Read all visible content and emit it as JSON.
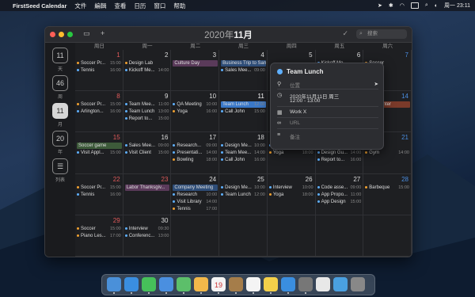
{
  "menubar": {
    "apple": "",
    "app": "FirstSeed Calendar",
    "items": [
      "文件",
      "編輯",
      "查看",
      "日历",
      "窗口",
      "帮助"
    ],
    "clock": "周一 23:11"
  },
  "window": {
    "title_year": "2020年",
    "title_month": "11月",
    "add_label": "+",
    "search_placeholder": "搜索",
    "check_label": "✓"
  },
  "sidebar": [
    {
      "num": "11",
      "label": "天"
    },
    {
      "num": "46",
      "label": "周"
    },
    {
      "num": "11",
      "label": "月"
    },
    {
      "num": "20",
      "label": "年"
    },
    {
      "num": "☰",
      "label": "列表"
    }
  ],
  "day_headers": [
    "周日",
    "周一",
    "周二",
    "周三",
    "周四",
    "周五",
    "周六"
  ],
  "weeks": [
    [
      {
        "d": "1",
        "c": "red",
        "ev": [
          {
            "t": "Soccer Pr...",
            "tm": "15:00",
            "col": "#f0a030"
          },
          {
            "t": "Tennis",
            "tm": "16:00",
            "col": "#5fb0ff"
          }
        ]
      },
      {
        "d": "2",
        "ev": [
          {
            "t": "Design Lab",
            "tm": "",
            "col": "#f0a030"
          },
          {
            "t": "Kickoff Me...",
            "tm": "14:00",
            "col": "#5fb0ff"
          }
        ]
      },
      {
        "d": "3",
        "ev": [
          {
            "t": "Culture Day",
            "bar": "#5a3a5a"
          }
        ]
      },
      {
        "d": "4",
        "ev": [
          {
            "t": "Business Trip to San Francisco",
            "bar": "#2e4d78"
          },
          {
            "t": "Sales Mee...",
            "tm": "09:00",
            "col": "#5fb0ff"
          }
        ]
      },
      {
        "d": "5",
        "ev": []
      },
      {
        "d": "6",
        "ev": [
          {
            "t": "Kickoff Me...",
            "tm": "",
            "col": "#5fb0ff"
          },
          {
            "t": "",
            "tm": "",
            "col": ""
          }
        ]
      },
      {
        "d": "7",
        "c": "blue",
        "ev": [
          {
            "t": "Soccer",
            "tm": "",
            "col": "#f0a030"
          },
          {
            "t": "Game",
            "tm": "",
            "col": "#5fb0ff"
          }
        ]
      }
    ],
    [
      {
        "d": "8",
        "c": "red",
        "ev": [
          {
            "t": "Soccer Pr...",
            "tm": "15:00",
            "col": "#f0a030"
          },
          {
            "t": "Arlington...",
            "tm": "16:00",
            "col": "#5fb0ff"
          }
        ]
      },
      {
        "d": "9",
        "ev": [
          {
            "t": "Team Mee...",
            "tm": "11:00",
            "col": "#5fb0ff"
          },
          {
            "t": "Team Lunch",
            "tm": "13:00",
            "col": "#5fb0ff"
          },
          {
            "t": "Report to...",
            "tm": "15:00",
            "col": "#5fb0ff"
          }
        ]
      },
      {
        "d": "10",
        "ev": [
          {
            "t": "QA Meeting",
            "tm": "10:00",
            "col": "#5fb0ff"
          },
          {
            "t": "Yoga",
            "tm": "16:00",
            "col": "#f0a030"
          }
        ]
      },
      {
        "d": "11",
        "c": "today",
        "ev": [
          {
            "t": "Team Lunch",
            "tm": "12:00",
            "bar": "#3a78c8"
          },
          {
            "t": "Call John",
            "tm": "15:00",
            "col": "#5fb0ff"
          }
        ]
      },
      {
        "d": "12",
        "ev": []
      },
      {
        "d": "13",
        "ev": []
      },
      {
        "d": "14",
        "c": "blue",
        "ev": [
          {
            "t": "Port Center",
            "bar": "#7a3a2a"
          }
        ]
      }
    ],
    [
      {
        "d": "15",
        "c": "red",
        "ev": [
          {
            "t": "Soccer game",
            "bar": "#3d5a3a"
          },
          {
            "t": "Visit Appl...",
            "tm": "15:00",
            "col": "#5fb0ff"
          }
        ]
      },
      {
        "d": "16",
        "ev": [
          {
            "t": "Sales Mee...",
            "tm": "09:00",
            "col": "#5fb0ff"
          },
          {
            "t": "Visit Client",
            "tm": "15:00",
            "col": "#5fb0ff"
          }
        ]
      },
      {
        "d": "17",
        "ev": [
          {
            "t": "Research...",
            "tm": "09:00",
            "col": "#5fb0ff"
          },
          {
            "t": "Presentati...",
            "tm": "14:00",
            "col": "#5fb0ff"
          },
          {
            "t": "Bowling",
            "tm": "18:00",
            "col": "#f0a030"
          }
        ]
      },
      {
        "d": "18",
        "ev": [
          {
            "t": "Design Me...",
            "tm": "10:00",
            "col": "#5fb0ff"
          },
          {
            "t": "Team Mee...",
            "tm": "14:00",
            "col": "#5fb0ff"
          },
          {
            "t": "Call John",
            "tm": "16:00",
            "col": "#5fb0ff"
          }
        ]
      },
      {
        "d": "19",
        "ev": [
          {
            "t": "Brainstor...",
            "tm": "10:00",
            "col": "#5fb0ff"
          },
          {
            "t": "Yoga",
            "tm": "18:00",
            "col": "#f0a030"
          }
        ]
      },
      {
        "d": "20",
        "ev": [
          {
            "t": "Visit Apple",
            "tm": "",
            "bar": "#2e4d78"
          },
          {
            "t": "Design Gu...",
            "tm": "14:00",
            "col": "#5fb0ff"
          },
          {
            "t": "Report to...",
            "tm": "16:00",
            "col": "#5fb0ff"
          }
        ]
      },
      {
        "d": "21",
        "c": "blue",
        "ev": [
          {
            "t": "",
            "tm": "",
            "col": ""
          },
          {
            "t": "Gym",
            "tm": "14:00",
            "col": "#f0a030"
          }
        ]
      }
    ],
    [
      {
        "d": "22",
        "c": "red",
        "ev": [
          {
            "t": "Soccer Pr...",
            "tm": "15:00",
            "col": "#f0a030"
          },
          {
            "t": "Tennis",
            "tm": "16:00",
            "col": "#5fb0ff"
          }
        ]
      },
      {
        "d": "23",
        "c": "red",
        "ev": [
          {
            "t": "Labor Thanksgiv...",
            "bar": "#5a3a5a"
          }
        ]
      },
      {
        "d": "24",
        "ev": [
          {
            "t": "Company Meeting",
            "bar": "#2e4d78"
          },
          {
            "t": "Research",
            "tm": "10:00",
            "col": "#5fb0ff"
          },
          {
            "t": "Visit Library",
            "tm": "14:00",
            "col": "#5fb0ff"
          },
          {
            "t": "Tennis",
            "tm": "17:00",
            "col": "#f0a030"
          }
        ]
      },
      {
        "d": "25",
        "ev": [
          {
            "t": "Design Me...",
            "tm": "10:00",
            "col": "#5fb0ff"
          },
          {
            "t": "Team Lunch",
            "tm": "12:00",
            "col": "#5fb0ff"
          }
        ]
      },
      {
        "d": "26",
        "ev": [
          {
            "t": "Interview",
            "tm": "10:00",
            "col": "#5fb0ff"
          },
          {
            "t": "Yoga",
            "tm": "18:00",
            "col": "#f0a030"
          }
        ]
      },
      {
        "d": "27",
        "ev": [
          {
            "t": "Code asse...",
            "tm": "09:00",
            "col": "#5fb0ff"
          },
          {
            "t": "App Propo...",
            "tm": "11:00",
            "col": "#5fb0ff"
          },
          {
            "t": "App Design",
            "tm": "15:00",
            "col": "#5fb0ff"
          }
        ]
      },
      {
        "d": "28",
        "c": "blue",
        "ev": [
          {
            "t": "Barbeque",
            "tm": "15:00",
            "col": "#f0a030"
          }
        ]
      }
    ],
    [
      {
        "d": "29",
        "c": "red",
        "ev": [
          {
            "t": "Soccer",
            "tm": "15:00",
            "col": "#f0a030"
          },
          {
            "t": "Piano Les...",
            "tm": "17:00",
            "col": "#f0a030"
          }
        ]
      },
      {
        "d": "30",
        "ev": [
          {
            "t": "Interview",
            "tm": "09:30",
            "col": "#5fb0ff"
          },
          {
            "t": "Conferenc...",
            "tm": "13:00",
            "col": "#5fb0ff"
          }
        ]
      },
      {
        "d": "",
        "ev": []
      },
      {
        "d": "",
        "ev": []
      },
      {
        "d": "",
        "ev": []
      },
      {
        "d": "",
        "ev": []
      },
      {
        "d": "",
        "ev": []
      }
    ]
  ],
  "popover": {
    "title": "Team Lunch",
    "location_placeholder": "位置",
    "date_line": "2020年11月11日 周三",
    "time_line": "12:00 - 13:00",
    "calendar": "Work X",
    "url_placeholder": "URL",
    "notes_placeholder": "备注"
  },
  "dock": [
    {
      "name": "finder-icon",
      "color": "#4a90d9"
    },
    {
      "name": "safari-icon",
      "color": "#3a8ee0"
    },
    {
      "name": "messages-icon",
      "color": "#46c05a"
    },
    {
      "name": "mail-icon",
      "color": "#4a8fe0"
    },
    {
      "name": "maps-icon",
      "color": "#5cbf6a"
    },
    {
      "name": "photos-icon",
      "color": "#f2b84a"
    },
    {
      "name": "calendar-icon",
      "color": "#f4f4f4"
    },
    {
      "name": "notes-brown-icon",
      "color": "#a57d4a"
    },
    {
      "name": "reminders-icon",
      "color": "#f4f4f4"
    },
    {
      "name": "notes-icon",
      "color": "#f4d04a"
    },
    {
      "name": "appstore-icon",
      "color": "#3a8ee0"
    },
    {
      "name": "system-prefs-icon",
      "color": "#777"
    },
    {
      "name": "firstseed-calendar-icon",
      "color": "#e8e8e8"
    },
    {
      "name": "folder-icon",
      "color": "#4aa0e0"
    },
    {
      "name": "trash-icon",
      "color": "#888"
    }
  ],
  "calendar_badge": "19"
}
